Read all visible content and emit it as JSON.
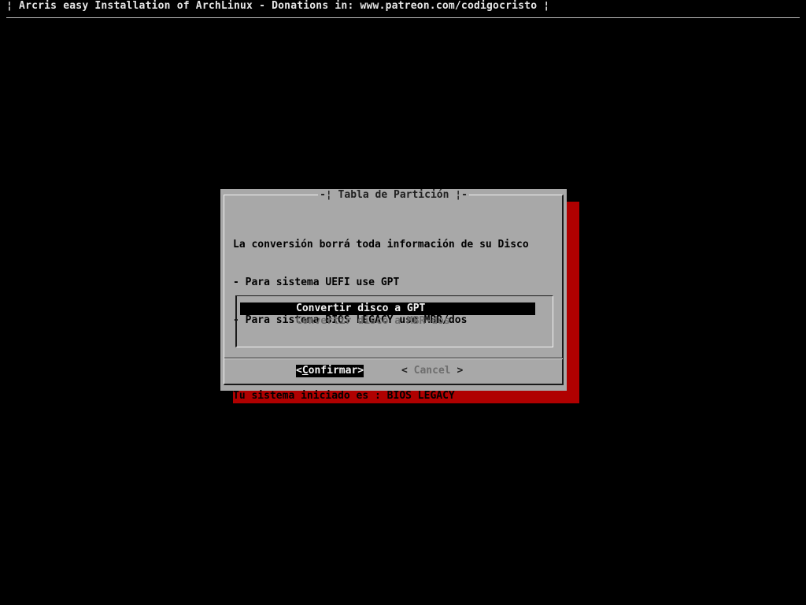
{
  "backtitle": "¦ Arcris easy Installation of ArchLinux - Donations in: www.patreon.com/codigocristo ¦",
  "dialog": {
    "title": "-¦ Tabla de Partición ¦-",
    "message_lines": [
      "La conversión borrá toda información de su Disco",
      "- Para sistema UEFI use GPT",
      "- Para sistema BIOS LEGACY use MBR/dos",
      "",
      "Tu sistema iniciado es : BIOS LEGACY"
    ],
    "menu_items": [
      {
        "label": "Convertir disco a GPT",
        "selected": true
      },
      {
        "label": "Convertir disco a MBR-dos",
        "selected": false
      }
    ],
    "buttons": {
      "confirm_open": "<",
      "confirm_hot": "C",
      "confirm_rest": "onfirmar>",
      "cancel_open": "<",
      "cancel_label": " Cancel ",
      "cancel_close": ">"
    }
  },
  "colors": {
    "background": "#000000",
    "dialog": "#a8a8a8",
    "shadow": "#b00000",
    "highlight": "#000000",
    "inactive_text": "#6e6e6e"
  }
}
